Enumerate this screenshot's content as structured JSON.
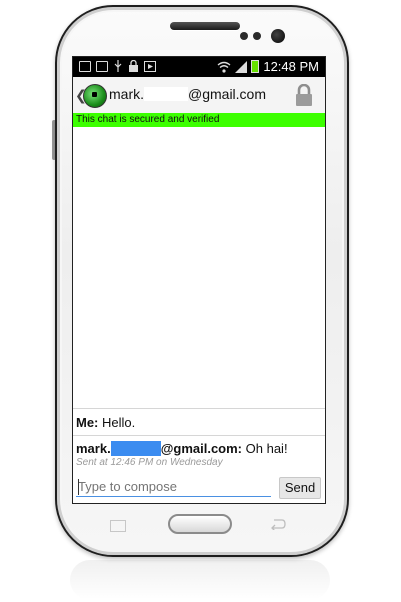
{
  "status_bar": {
    "time": "12:48 PM",
    "icons": [
      "image-icon",
      "voicemail-icon",
      "usb-icon",
      "lock-icon",
      "media-icon",
      "wifi-icon",
      "signal-icon",
      "battery-charging-icon"
    ]
  },
  "header": {
    "title_prefix": "mark.",
    "title_suffix": "@gmail.com",
    "back_glyph": "❮"
  },
  "banner": {
    "text": "This chat is secured and verified",
    "color": "#3cff00"
  },
  "messages": [
    {
      "sender": "Me:",
      "text": "Hello."
    },
    {
      "sender_prefix": "mark.",
      "sender_suffix": "@gmail.com:",
      "text": "Oh hai!",
      "meta": "Sent at 12:46 PM on Wednesday"
    }
  ],
  "composer": {
    "placeholder": "Type to compose",
    "send_label": "Send"
  },
  "colors": {
    "redaction_blue": "#3b8cf0",
    "input_underline": "#4a90e2"
  }
}
